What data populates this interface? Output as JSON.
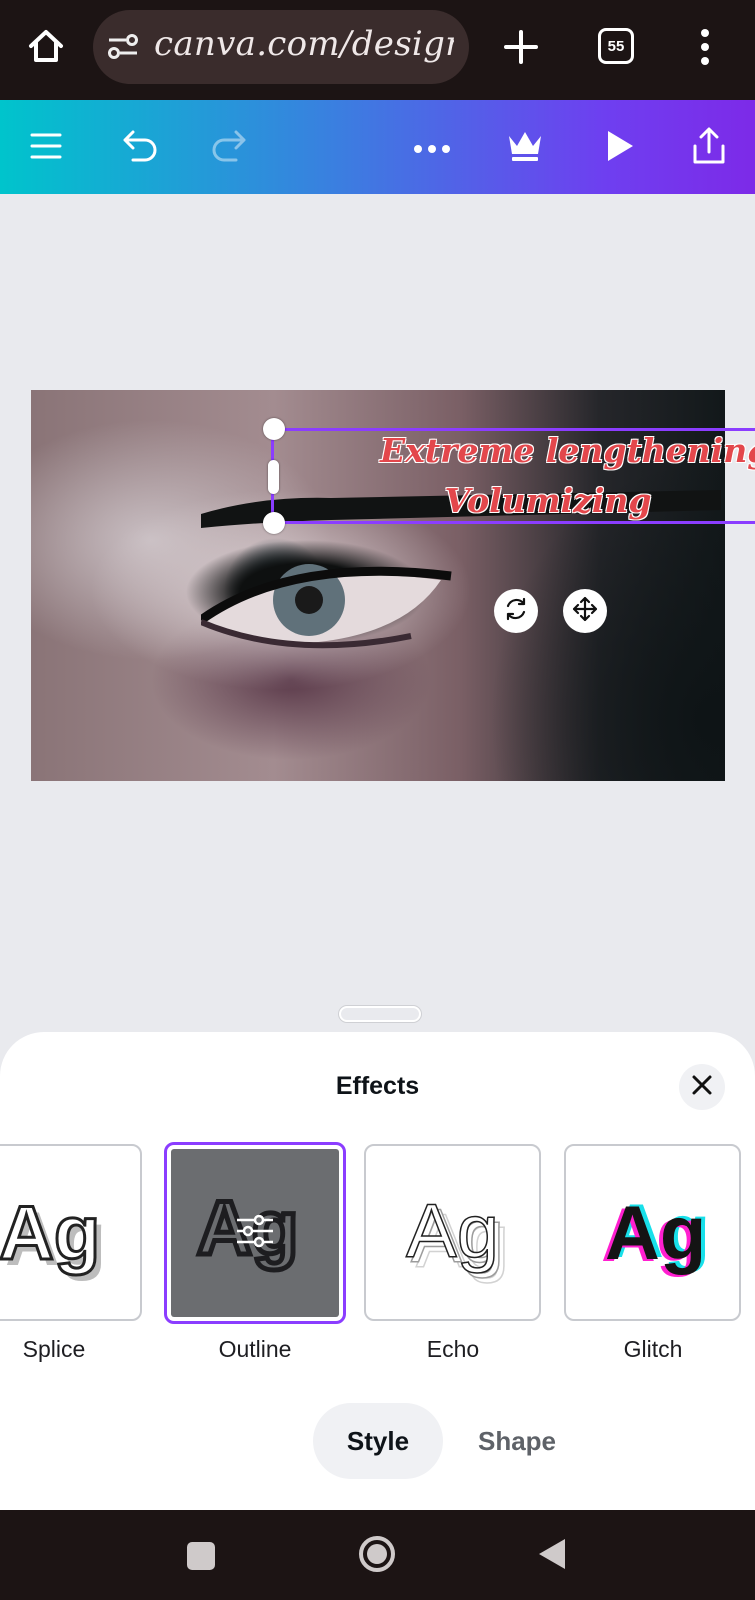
{
  "browser": {
    "url": "canva.com/design/D",
    "tab_count": "55"
  },
  "canvas": {
    "text_line1": "Extreme lengthening",
    "text_line2": "Volumizing",
    "text_color": "#e3474c"
  },
  "sheet": {
    "title": "Effects",
    "effects": [
      {
        "label": "Splice",
        "preview": "Ag"
      },
      {
        "label": "Outline",
        "preview": "Ag",
        "selected": true
      },
      {
        "label": "Echo",
        "preview": "Ag"
      },
      {
        "label": "Glitch",
        "preview": "Ag"
      }
    ],
    "tabs": [
      {
        "label": "Style",
        "active": true
      },
      {
        "label": "Shape",
        "active": false
      }
    ]
  },
  "colors": {
    "selection": "#8b3dff",
    "toolbar_gradient_start": "#00c4cc",
    "toolbar_gradient_end": "#7d2ae8"
  },
  "icons": [
    "home-icon",
    "site-settings-icon",
    "new-tab-icon",
    "tabs-icon",
    "more-vertical-icon",
    "menu-icon",
    "undo-icon",
    "redo-icon",
    "more-horizontal-icon",
    "crown-icon",
    "play-icon",
    "share-icon",
    "rotate-icon",
    "move-icon",
    "close-icon",
    "adjust-sliders-icon",
    "nav-square-icon",
    "nav-circle-icon",
    "nav-back-icon"
  ]
}
